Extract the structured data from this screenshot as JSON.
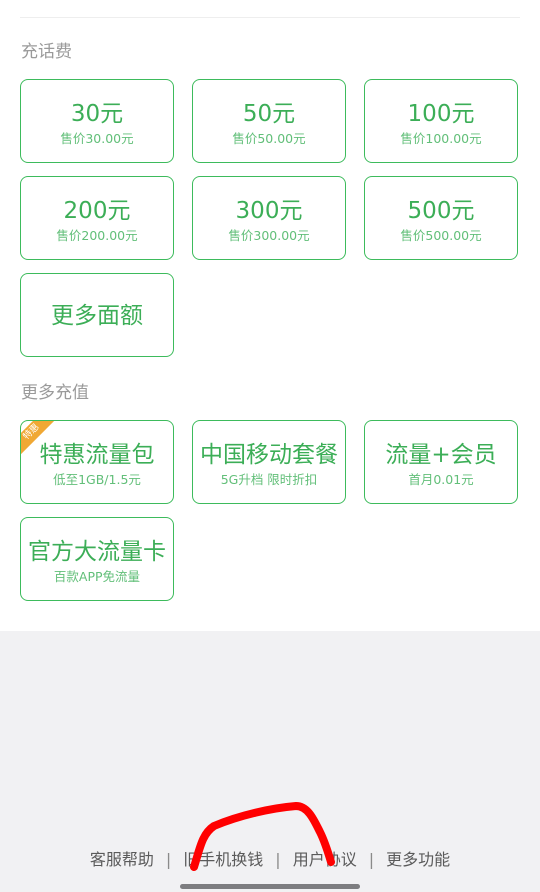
{
  "recharge": {
    "title": "充话费",
    "options": [
      {
        "amount": "30元",
        "price": "售价30.00元"
      },
      {
        "amount": "50元",
        "price": "售价50.00元"
      },
      {
        "amount": "100元",
        "price": "售价100.00元"
      },
      {
        "amount": "200元",
        "price": "售价200.00元"
      },
      {
        "amount": "300元",
        "price": "售价300.00元"
      },
      {
        "amount": "500元",
        "price": "售价500.00元"
      }
    ],
    "more_label": "更多面额"
  },
  "more_recharge": {
    "title": "更多充值",
    "items": [
      {
        "title": "特惠流量包",
        "subtitle": "低至1GB/1.5元",
        "badge": "特惠"
      },
      {
        "title": "中国移动套餐",
        "subtitle": "5G升档 限时折扣"
      },
      {
        "title": "流量+会员",
        "subtitle": "首月0.01元"
      },
      {
        "title": "官方大流量卡",
        "subtitle": "百款APP免流量"
      }
    ]
  },
  "footer": {
    "links": [
      "客服帮助",
      "旧手机换钱",
      "用户协议",
      "更多功能"
    ]
  },
  "colors": {
    "accent_green": "#3cae57",
    "border_green": "#3dbb5c",
    "badge_orange": "#f0a834",
    "annotation_red": "#ff0000"
  }
}
